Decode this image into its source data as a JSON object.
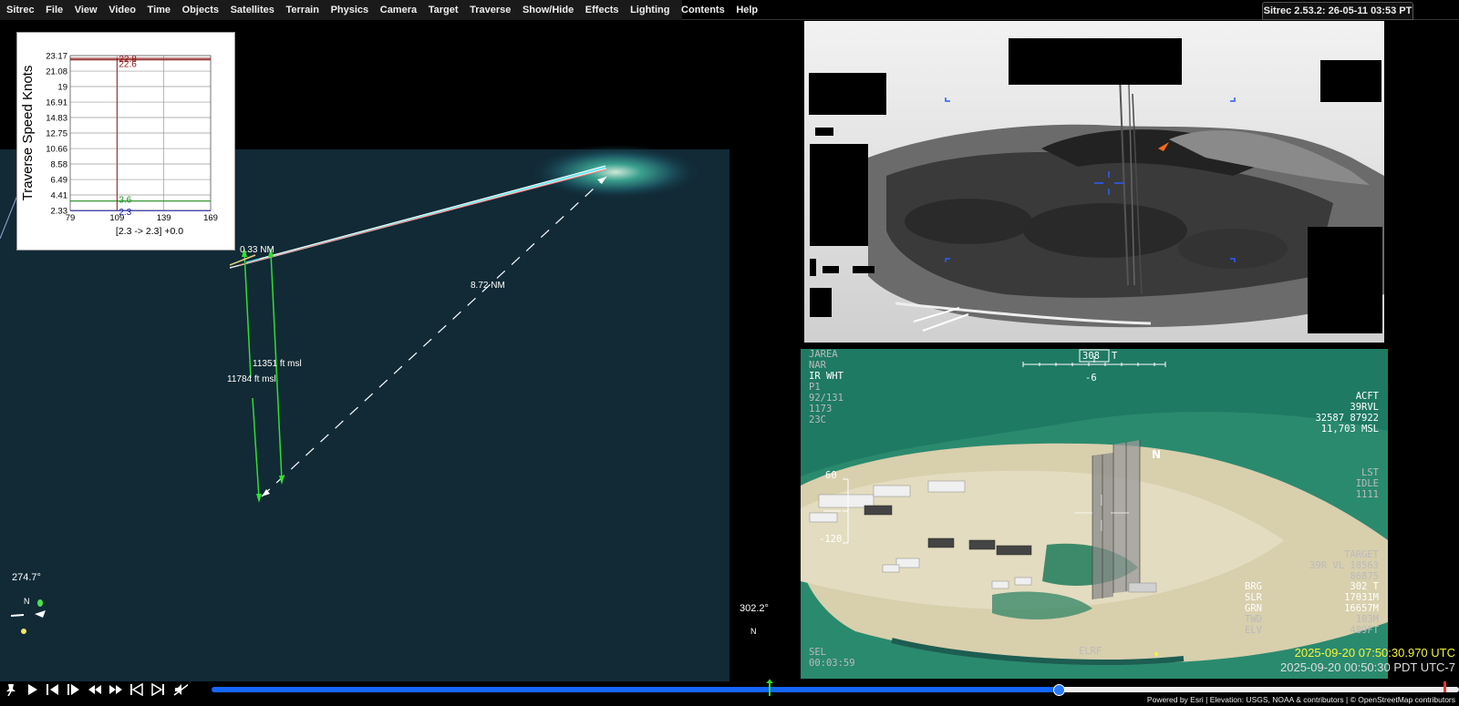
{
  "menubar": {
    "items": [
      "Sitrec",
      "File",
      "View",
      "Video",
      "Time",
      "Objects",
      "Satellites",
      "Terrain",
      "Physics",
      "Camera",
      "Target",
      "Traverse",
      "Show/Hide",
      "Effects",
      "Lighting",
      "Contents",
      "Help"
    ],
    "version": "Sitrec 2.53.2: 26-05-11 03:53 PT"
  },
  "main_view": {
    "distance_short": "0.33 NM",
    "distance_long": "8.72 NM",
    "alt_1": "11351 ft msl",
    "alt_2": "11784 ft msl",
    "heading": "274.7°"
  },
  "chart_data": {
    "type": "line",
    "ylabel": "Traverse Speed Knots",
    "yticks": [
      "23.17",
      "21.08",
      "19",
      "16.91",
      "14.83",
      "12.75",
      "10.66",
      "8.58",
      "6.49",
      "4.41",
      "2.33"
    ],
    "xticks": [
      "79",
      "109",
      "139",
      "169"
    ],
    "ylim": [
      2.33,
      23.17
    ],
    "xlim": [
      79,
      169
    ],
    "caption": "[2.3 -> 2.3] +0.0",
    "series": [
      {
        "label": "22.8",
        "color": "#8b1a1a",
        "values_y": [
          22.8
        ]
      },
      {
        "label": "22.6",
        "color": "#8b1a1a",
        "values_y": [
          22.6
        ]
      },
      {
        "label": "3.6",
        "color": "#1e8c1e",
        "values_y": [
          3.6
        ]
      },
      {
        "label": "2.3",
        "color": "#1a1aa0",
        "values_y": [
          2.3
        ]
      }
    ],
    "marker_x": 109
  },
  "lookview": {
    "left": [
      "JAREA",
      "NAR",
      "IR WHT",
      "P1",
      "92/131",
      "1173",
      "23C"
    ],
    "heading_box": "308",
    "heading_suffix": "T",
    "pitch": "-6",
    "acft": [
      "ACFT",
      "39RVL",
      "32587 87922",
      "11,703 MSL"
    ],
    "mode": [
      "LST",
      "IDLE",
      "1111"
    ],
    "target_label": "TARGET",
    "target_coord": "39R VL 18563",
    "target_coord2": "86875",
    "meas_labels": [
      "BRG",
      "SLR",
      "GRN",
      "TWD",
      "ELV"
    ],
    "meas_values": [
      "302 T",
      "17031M",
      "16657M",
      "103M",
      "489FT"
    ],
    "scale": [
      "60",
      "-120"
    ],
    "sel": "SEL",
    "sel_time": "00:03:59",
    "elrf": "ELRF",
    "north": "N",
    "utc": "2025-09-20 07:50:30.970 UTC",
    "pdt": "2025-09-20 00:50:30 PDT UTC-7"
  },
  "lookview_heading": "302.2°",
  "north_label": "N",
  "controls": [
    "pin",
    "play",
    "step-back",
    "step-forward",
    "rewind",
    "fast-forward",
    "to-start",
    "to-end",
    "mute"
  ],
  "timeline_progress": 0.68,
  "attribution": "Powered by Esri | Elevation: USGS, NOAA & contributors | © OpenStreetMap contributors"
}
